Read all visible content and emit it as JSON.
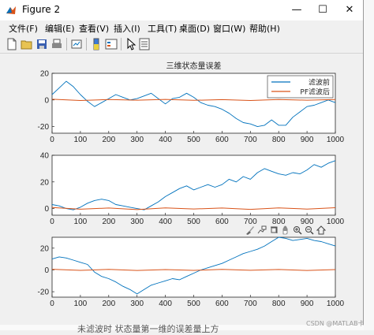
{
  "window": {
    "title": "Figure 2",
    "controls": {
      "minimize": "—",
      "maximize": "☐",
      "close": "✕"
    }
  },
  "menu": [
    "文件(F)",
    "编辑(E)",
    "查看(V)",
    "插入(I)",
    "工具(T)",
    "桌面(D)",
    "窗口(W)",
    "帮助(H)"
  ],
  "toolbar": {
    "icons": [
      "new-file-icon",
      "open-folder-icon",
      "save-icon",
      "print-icon",
      "link-plot-icon",
      "insert-colorbar-icon",
      "insert-legend-icon",
      "edit-plot-arrow-icon",
      "property-inspector-icon"
    ]
  },
  "axes_toolbar": {
    "icons": [
      "brush-icon",
      "data-tips-icon",
      "rotate-3d-icon",
      "pan-icon",
      "zoom-in-icon",
      "zoom-out-icon",
      "home-icon"
    ]
  },
  "colors": {
    "series_before": "#0072bd",
    "series_after": "#d95319",
    "axes_bg": "#ffffff",
    "figure_bg": "#f0f0f0"
  },
  "chart_data": [
    {
      "type": "line",
      "title": "三维状态量误差",
      "xlim": [
        0,
        1000
      ],
      "ylim": [
        -25,
        20
      ],
      "xticks": [
        0,
        100,
        200,
        300,
        400,
        500,
        600,
        700,
        800,
        900,
        1000
      ],
      "yticks": [
        -20,
        0,
        20
      ],
      "grid": false,
      "legend": {
        "position": "top-right",
        "entries": [
          "滤波前",
          "PF滤波后"
        ]
      },
      "series": [
        {
          "name": "滤波前",
          "color": "#0072bd",
          "x": [
            0,
            25,
            50,
            75,
            100,
            125,
            150,
            175,
            200,
            225,
            250,
            275,
            300,
            325,
            350,
            375,
            400,
            425,
            450,
            475,
            500,
            525,
            550,
            575,
            600,
            625,
            650,
            675,
            700,
            725,
            750,
            775,
            800,
            825,
            850,
            875,
            900,
            925,
            950,
            975,
            1000
          ],
          "values": [
            4,
            9,
            14,
            10,
            4,
            -1,
            -5,
            -2,
            1,
            4,
            2,
            0,
            1,
            3,
            5,
            1,
            -3,
            1,
            2,
            5,
            2,
            -2,
            -4,
            -5,
            -7,
            -10,
            -14,
            -17,
            -18,
            -20,
            -19,
            -15,
            -19,
            -19,
            -13,
            -9,
            -5,
            -4,
            -2,
            0,
            -2
          ]
        },
        {
          "name": "PF滤波后",
          "color": "#d95319",
          "x": [
            0,
            100,
            200,
            300,
            400,
            500,
            600,
            700,
            800,
            900,
            1000
          ],
          "values": [
            0.5,
            -0.4,
            0.3,
            -0.2,
            0.4,
            -0.3,
            0.2,
            -0.4,
            0.3,
            -0.2,
            0.3
          ]
        }
      ]
    },
    {
      "type": "line",
      "xlim": [
        0,
        1000
      ],
      "ylim": [
        -5,
        40
      ],
      "xticks": [
        0,
        100,
        200,
        300,
        400,
        500,
        600,
        700,
        800,
        900,
        1000
      ],
      "yticks": [
        0,
        20,
        40
      ],
      "grid": false,
      "series": [
        {
          "color": "#0072bd",
          "x": [
            0,
            25,
            50,
            75,
            100,
            125,
            150,
            175,
            200,
            225,
            250,
            275,
            300,
            325,
            350,
            375,
            400,
            425,
            450,
            475,
            500,
            525,
            550,
            575,
            600,
            625,
            650,
            675,
            700,
            725,
            750,
            775,
            800,
            825,
            850,
            875,
            900,
            925,
            950,
            975,
            1000
          ],
          "values": [
            3,
            2,
            0,
            -1,
            1,
            4,
            6,
            7,
            6,
            3,
            2,
            1,
            0,
            -1,
            2,
            5,
            9,
            12,
            15,
            17,
            14,
            16,
            18,
            16,
            18,
            22,
            20,
            24,
            22,
            27,
            30,
            28,
            26,
            25,
            27,
            26,
            29,
            33,
            31,
            34,
            36
          ]
        },
        {
          "color": "#d95319",
          "x": [
            0,
            100,
            200,
            300,
            400,
            500,
            600,
            700,
            800,
            900,
            1000
          ],
          "values": [
            0.8,
            -0.5,
            0.4,
            -0.8,
            0.5,
            -0.3,
            0.4,
            -0.6,
            0.5,
            -0.4,
            0.6
          ]
        }
      ]
    },
    {
      "type": "line",
      "xlim": [
        0,
        1000
      ],
      "ylim": [
        -25,
        30
      ],
      "xticks": [
        0,
        100,
        200,
        300,
        400,
        500,
        600,
        700,
        800,
        900,
        1000
      ],
      "yticks": [
        -20,
        0,
        20
      ],
      "grid": false,
      "series": [
        {
          "color": "#0072bd",
          "x": [
            0,
            25,
            50,
            75,
            100,
            125,
            150,
            175,
            200,
            225,
            250,
            275,
            300,
            325,
            350,
            375,
            400,
            425,
            450,
            475,
            500,
            525,
            550,
            575,
            600,
            625,
            650,
            675,
            700,
            725,
            750,
            775,
            800,
            825,
            850,
            875,
            900,
            925,
            950,
            975,
            1000
          ],
          "values": [
            10,
            12,
            11,
            9,
            7,
            5,
            -2,
            -6,
            -8,
            -11,
            -15,
            -18,
            -22,
            -18,
            -14,
            -12,
            -10,
            -8,
            -9,
            -6,
            -3,
            0,
            2,
            4,
            6,
            9,
            12,
            15,
            17,
            19,
            22,
            26,
            30,
            29,
            27,
            28,
            29,
            27,
            26,
            24,
            22
          ]
        },
        {
          "color": "#d95319",
          "x": [
            0,
            100,
            200,
            300,
            400,
            500,
            600,
            700,
            800,
            900,
            1000
          ],
          "values": [
            0.6,
            -0.4,
            0.5,
            -0.5,
            0.3,
            -0.4,
            0.5,
            -0.3,
            0.4,
            -0.5,
            0.3
          ]
        }
      ]
    }
  ],
  "background_text": {
    "bottom_text": "未滤波时 状态量第一维的误差量上方",
    "watermark": "CSDN @MATLAB卡尔曼"
  }
}
